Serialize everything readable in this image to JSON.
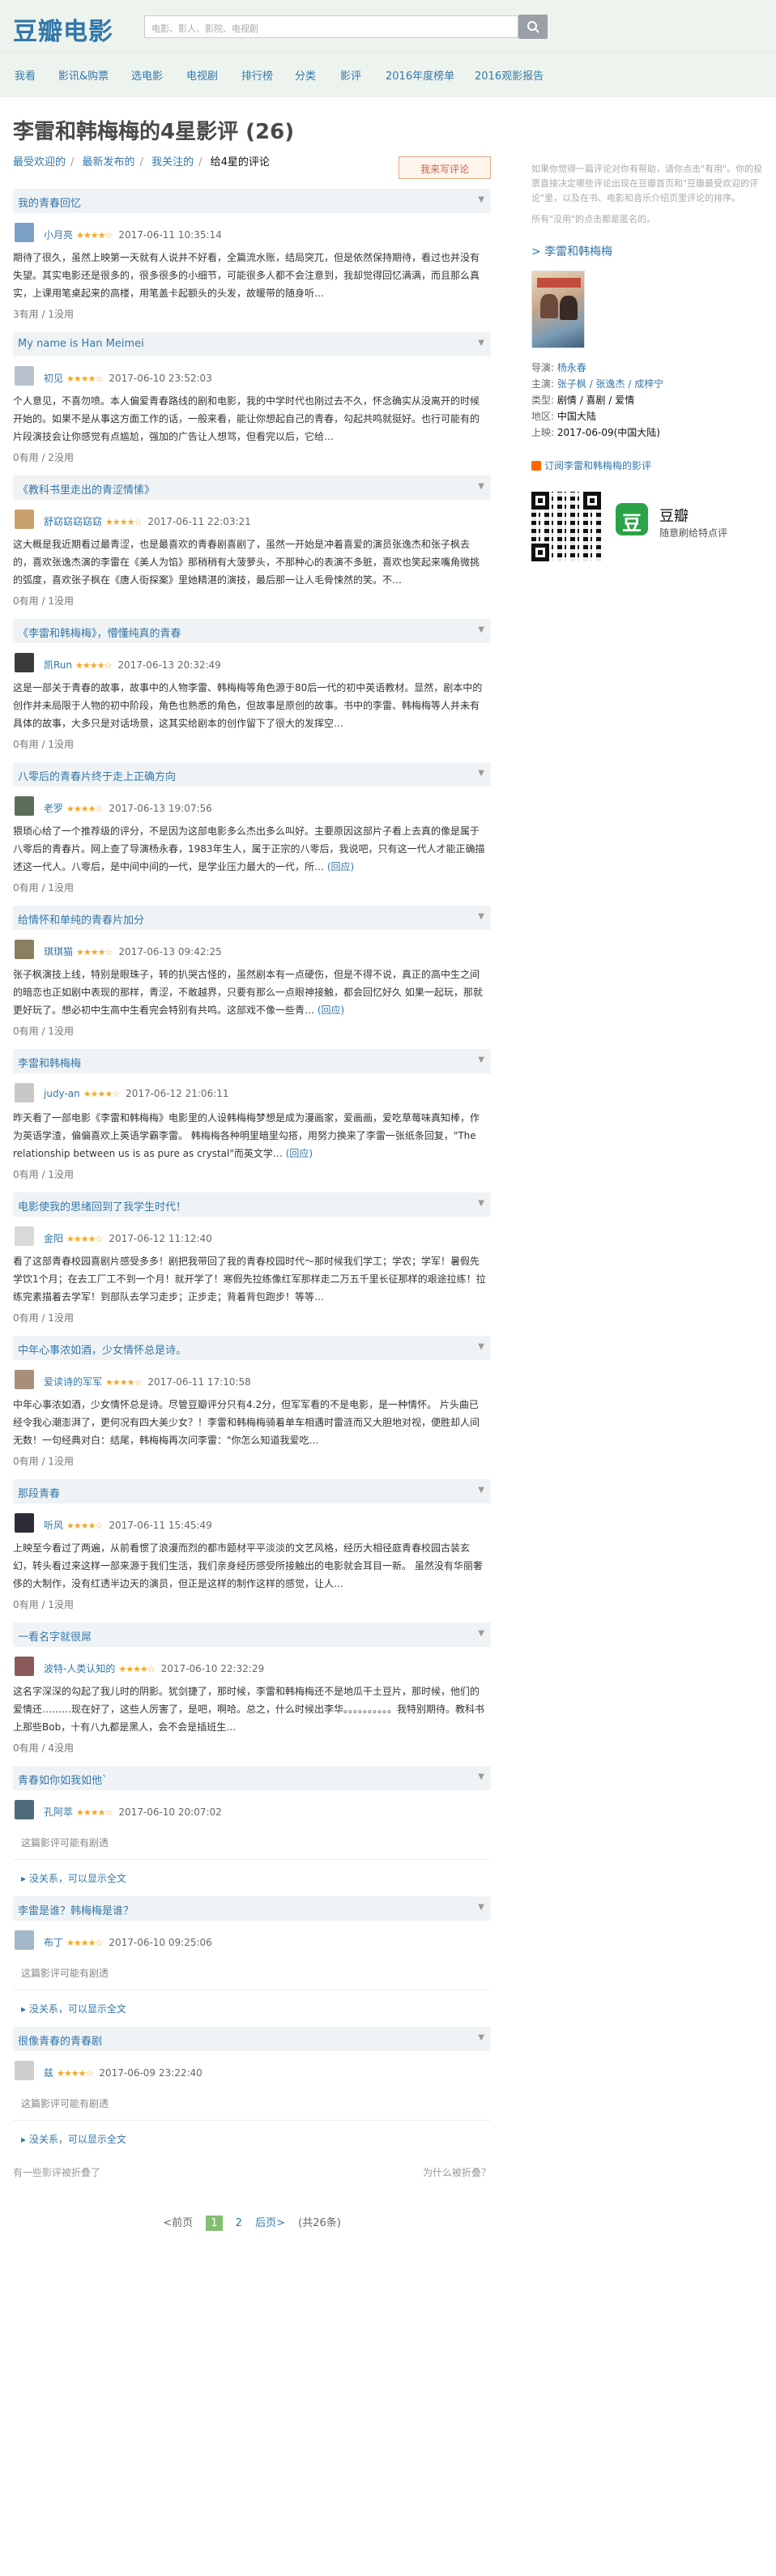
{
  "header": {
    "logo": "豆瓣电影",
    "search_placeholder": "电影、影人、影院、电视剧"
  },
  "nav": [
    "我看",
    "影讯&购票",
    "选电影",
    "电视剧",
    "排行榜",
    "分类",
    "影评",
    "2016年度榜单",
    "2016观影报告"
  ],
  "page": {
    "title": "李雷和韩梅梅的4星影评 (26)",
    "tabs": [
      "最受欢迎的",
      "最新发布的",
      "我关注的"
    ],
    "current_tab": "给4星的评论",
    "write_button": "我来写评论"
  },
  "reviews": [
    {
      "title": "我的青春回忆",
      "author": "小月亮",
      "stars": "★★★★☆",
      "date": "2017-06-11 10:35:14",
      "body": "期待了很久，虽然上映第一天就有人说并不好看，全篇流水账，结局突兀，但是依然保持期待，看过也并没有失望。其实电影还是很多的，很多很多的小细节，可能很多人都不会注意到，我却觉得回忆满满，而且那么真实，上课用笔桌起来的高楼，用笔盖卡起额头的头发，故暖带的随身听…",
      "more": "",
      "count": "3有用 / 1没用"
    },
    {
      "title": "My name is Han Meimei",
      "author": "初见",
      "stars": "★★★★☆",
      "date": "2017-06-10 23:52:03",
      "body": "个人意见，不喜勿喷。本人偏爱青春路线的剧和电影，我的中学时代也刚过去不久，怀念确实从没离开的时候开始的。如果不是从事这方面工作的话，一般来看，能让你想起自己的青春，勾起共鸣就挺好。也行可能有的片段演技会让你感觉有点尴尬，强加的广告让人想骂，但看完以后，它给…",
      "more": "",
      "count": "0有用 / 2没用"
    },
    {
      "title": "《教科书里走出的青涩情愫》",
      "author": "舒窈窈窈窈窈",
      "stars": "★★★★☆",
      "date": "2017-06-11 22:03:21",
      "body": "这大概是我近期看过最青涩，也是最喜欢的青春剧喜剧了，虽然一开始是冲着喜爱的演员张逸杰和张子枫去的，喜欢张逸杰演的李雷在《美人为馅》那稍稍有大菠萝头，不那种心的表演不多脏，喜欢也笑起来嘴角微挑的弧度，喜欢张子枫在《唐人街探案》里她精湛的演技，最后那一让人毛骨悚然的笑。不…",
      "more": "",
      "count": "0有用 / 1没用"
    },
    {
      "title": "《李雷和韩梅梅》，懵懂纯真的青春",
      "author": "凯Run",
      "stars": "★★★★☆",
      "date": "2017-06-13 20:32:49",
      "body": "这是一部关于青春的故事，故事中的人物李雷、韩梅梅等角色源于80后一代的初中英语教材。显然，剧本中的创作并未局限于人物的初中阶段，角色也熟悉的角色，但故事是原创的故事。书中的李雷、韩梅梅等人并未有具体的故事，大多只是对话场景，这其实给剧本的创作留下了很大的发挥空…",
      "more": "",
      "count": "0有用 / 1没用"
    },
    {
      "title": "八零后的青春片终于走上正确方向",
      "author": "老罗",
      "stars": "★★★★☆",
      "date": "2017-06-13 19:07:56",
      "body": "猥琐心给了一个推荐级的评分，不是因为这部电影多么杰出多么叫好。主要原因这部片子看上去真的像是属于八零后的青春片。网上查了导演杨永春，1983年生人，属于正宗的八零后，我说吧，只有这一代人才能正确描述这一代人。八零后，是中间中间的一代，是学业压力最大的一代，所…",
      "more": "(回应)",
      "count": "0有用 / 1没用"
    },
    {
      "title": "给情怀和单纯的青春片加分",
      "author": "琪琪猫",
      "stars": "★★★★☆",
      "date": "2017-06-13 09:42:25",
      "body": "张子枫演技上线，特别是眼珠子，转的扒哭古怪的，虽然剧本有一点硬伤，但是不得不说，真正的高中生之间的暗恋也正如剧中表现的那样，青涩，不敢越界，只要有那么一点眼神接触，都会回忆好久 如果一起玩，那就更好玩了。想必初中生高中生看完会特别有共鸣。这部戏不像一些青…",
      "more": "(回应)",
      "count": "0有用 / 1没用"
    },
    {
      "title": "李雷和韩梅梅",
      "author": "judy-an",
      "stars": "★★★★☆",
      "date": "2017-06-12 21:06:11",
      "body": "昨天看了一部电影《李雷和韩梅梅》电影里的人设韩梅梅梦想是成为漫画家，爱画画，爱吃草莓味真知棒，作为英语学渣，偏偏喜欢上英语学霸李雷。 韩梅梅各种明里暗里勾搭，用努力换来了李雷一张纸条回复，\"The relationship between us is as pure as crystal\"而英文学…",
      "more": "(回应)",
      "count": "0有用 / 1没用"
    },
    {
      "title": "电影使我的思绪回到了我学生时代！",
      "author": "金阳",
      "stars": "★★★★☆",
      "date": "2017-06-12 11:12:40",
      "body": "看了这部青春校园喜剧片感受多多！剧把我带回了我的青春校园时代～那时候我们学工；学农；学军！暑假先学饮1个月；在去工厂工不到一个月！就开学了！寒假先拉练像红军那样走二万五千里长征那样的艰途拉练！拉练完素描着去学军！到部队去学习走步；正步走；背着背包跑步！等等…",
      "more": "",
      "count": "0有用 / 1没用"
    },
    {
      "title": "中年心事浓如酒，少女情怀总是诗。",
      "author": "爱读诗的军军",
      "stars": "★★★★☆",
      "date": "2017-06-11 17:10:58",
      "body": "中年心事浓如酒，少女情怀总是诗。尽管豆瓣评分只有4.2分，但军军看的不是电影，是一种情怀。 片头曲已经令我心潮澎湃了，更何况有四大美少女？！李雷和韩梅梅骑着单车相遇时雷涟而又大胆地对视，便胜却人间无数！一句经典对白：结尾，韩梅梅再次问李雷：\"你怎么知道我爱吃…",
      "more": "",
      "count": "0有用 / 1没用"
    },
    {
      "title": "那段青春",
      "author": "听风",
      "stars": "★★★★☆",
      "date": "2017-06-11 15:45:49",
      "body": "上映至今看过了两遍，从前看惯了浪漫而烈的都市题材平平淡淡的文艺风格，经历大相径庭青春校园古装玄幻，转头看过来这样一部来源于我们生活，我们亲身经历感受所接触出的电影就会耳目一新。 虽然没有华丽奢侈的大制作，没有红透半边天的演员，但正是这样的制作这样的感觉，让人…",
      "more": "",
      "count": "0有用 / 1没用"
    },
    {
      "title": "一看名字就很屌",
      "author": "波特-人类认知的",
      "stars": "★★★★☆",
      "date": "2017-06-10 22:32:29",
      "body": "这名字深深的勾起了我儿时的阴影。犹剑捷了，那时候，李雷和韩梅梅还不是地瓜干土豆片，那时候，他们的爱情还………现在好了，这些人厉害了，是吧，啊哈。总之，什么时候出李华。。。。。。。。。。我特别期待。教科书上那些Bob，十有八九都是黑人，会不会是插班生…",
      "more": "",
      "count": "0有用 / 4没用"
    }
  ],
  "folded_reviews": [
    {
      "title": "青春如你如我如他`",
      "author": "孔阿萃",
      "stars": "★★★★☆",
      "date": "2017-06-10 20:07:02",
      "note": "这篇影评可能有剧透",
      "link": "没关系，可以显示全文"
    },
    {
      "title": "李雷是谁？韩梅梅是谁？",
      "author": "布丁",
      "stars": "★★★★☆",
      "date": "2017-06-10 09:25:06",
      "note": "这篇影评可能有剧透",
      "link": "没关系，可以显示全文"
    },
    {
      "title": "很像青春的青春剧",
      "author": "兹",
      "stars": "★★★★☆",
      "date": "2017-06-09 23:22:40",
      "note": "这篇影评可能有剧透",
      "link": "没关系，可以显示全文"
    }
  ],
  "fold": {
    "left": "有一些影评被折叠了",
    "right": "为什么被折叠？"
  },
  "pager": {
    "prev": "<前页",
    "p1": "1",
    "p2": "2",
    "next": "后页>",
    "total": "(共26条)"
  },
  "aside": {
    "note": "如果你觉得一篇评论对你有帮助，请你点击\"有用\"。你的投票直接决定哪些评论出现在豆瓣首页和\"豆瓣最受欢迎的评论\"里，以及在书、电影和音乐介绍页里评论的排序。",
    "note2": "所有\"没用\"的点击都是匿名的。",
    "movie_link": "> 李雷和韩梅梅",
    "info": [
      {
        "k": "导演:",
        "v": "杨永春"
      },
      {
        "k": "主演:",
        "v": "张子枫 / 张逸杰 / 成梓宁"
      },
      {
        "k": "类型:",
        "v": "剧情 / 喜剧 / 爱情"
      },
      {
        "k": "地区:",
        "v": "中国大陆"
      },
      {
        "k": "上映:",
        "v": "2017-06-09(中国大陆)"
      }
    ],
    "rss": "订阅李雷和韩梅梅的影评",
    "app_icon": "豆",
    "app_name": "豆瓣",
    "app_desc": "随意刷给特点评"
  }
}
